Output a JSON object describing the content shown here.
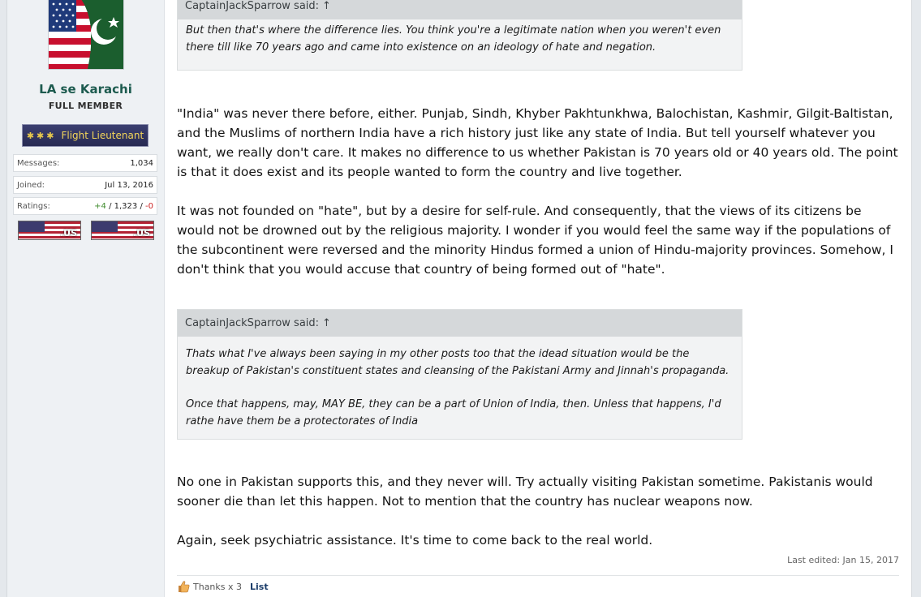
{
  "user": {
    "name": "LA se Karachi",
    "title": "FULL MEMBER",
    "rank": "Flight Lieutenant",
    "stats": {
      "messages_label": "Messages:",
      "messages": "1,034",
      "joined_label": "Joined:",
      "joined": "Jul 13, 2016",
      "ratings_label": "Ratings:",
      "ratings_pos": "+4",
      "ratings_mid": "1,323",
      "ratings_neg": "-0",
      "ratings_sep": "/"
    },
    "flags": [
      ".US",
      ".US"
    ]
  },
  "post": {
    "quote1": {
      "author": "CaptainJackSparrow said:",
      "arrow": "↑",
      "text": "But then that's where the difference lies. You think you're a legitimate nation when you weren't even there till like 70 years ago and came into existence on an ideology of hate and negation."
    },
    "para1": "\"India\" was never there before, either. Punjab, Sindh, Khyber Pakhtunkhwa, Balochistan, Kashmir, Gilgit-Baltistan, and the Muslims of northern India have a rich history just like any state of India. But tell yourself whatever you want, we really don't care. It makes no difference to us whether Pakistan is 70 years old or 40 years old. The point is that it does exist and its people wanted to form the country and live together.",
    "para2": "It was not founded on \"hate\", but by a desire for self-rule. And consequently, that the views of its citizens be would not be drowned out by the religious majority. I wonder if you would feel the same way if the populations of the subcontinent were reversed and the minority Hindus formed a union of Hindu-majority provinces. Somehow, I don't think that you would accuse that country of being formed out of \"hate\".",
    "quote2": {
      "author": "CaptainJackSparrow said:",
      "arrow": "↑",
      "text1": "Thats what I've always been saying in my other posts too that the idead situation would be the breakup of Pakistan's constituent states and cleansing of the Pakistani Army and Jinnah's propaganda.",
      "text2": "Once that happens, may, MAY BE, they can be a part of Union of India, then. Unless that happens, I'd rathe have them be a protectorates of India"
    },
    "para3": "No one in Pakistan supports this, and they never will. Try actually visiting Pakistan sometime. Pakistanis would sooner die than let this happen. Not to mention that the country has nuclear weapons now.",
    "para4": "Again, seek psychiatric assistance. It's time to come back to the real world.",
    "edited": "Last edited: Jan 15, 2017",
    "thanks": "Thanks x 3",
    "list_label": "List"
  }
}
